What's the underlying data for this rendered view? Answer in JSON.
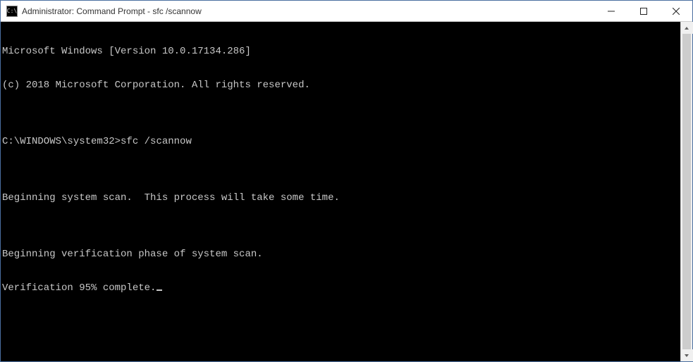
{
  "window": {
    "title": "Administrator: Command Prompt - sfc  /scannow",
    "icon_label": "C:\\"
  },
  "controls": {
    "minimize": "minimize",
    "maximize": "maximize",
    "close": "close"
  },
  "terminal": {
    "banner_version": "Microsoft Windows [Version 10.0.17134.286]",
    "banner_copyright": "(c) 2018 Microsoft Corporation. All rights reserved.",
    "blank1": "",
    "prompt": "C:\\WINDOWS\\system32>",
    "command": "sfc /scannow",
    "blank2": "",
    "msg_begin_scan": "Beginning system scan.  This process will take some time.",
    "blank3": "",
    "msg_verify_phase": "Beginning verification phase of system scan.",
    "msg_verify_pct": "Verification 95% complete."
  }
}
